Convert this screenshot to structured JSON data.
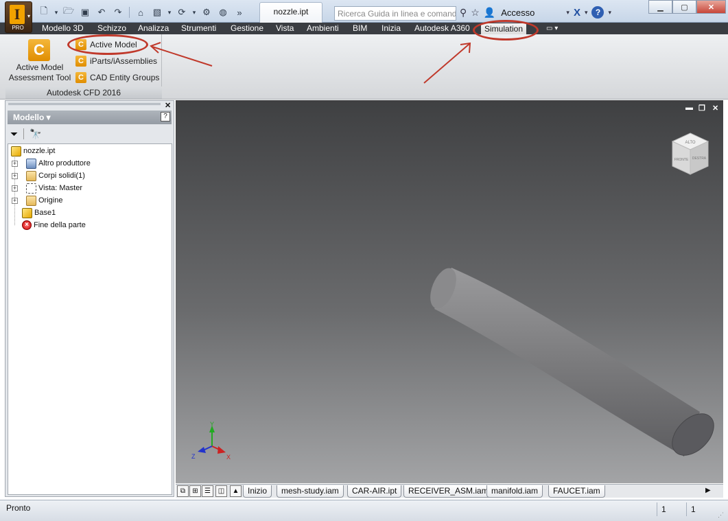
{
  "titlebar": {
    "app_badge": "I",
    "app_edition": "PRO",
    "document_title": "nozzle.ipt",
    "search_placeholder": "Ricerca Guida in linea e comand",
    "signin_label": "Accesso",
    "quick_access_icons": [
      "new-icon",
      "open-icon",
      "save-icon",
      "undo-icon",
      "redo-icon",
      "home-icon",
      "appearance-icon",
      "update-icon",
      "material-icon",
      "more-icon"
    ]
  },
  "ribbon_tabs": [
    "Modello 3D",
    "Schizzo",
    "Analizza",
    "Strumenti",
    "Gestione",
    "Vista",
    "Ambienti",
    "BIM",
    "Inizia",
    "Autodesk A360",
    "Simulation"
  ],
  "active_ribbon_tab": "Simulation",
  "ribbon_panel": {
    "large_button": {
      "line1": "Active Model",
      "line2": "Assessment Tool"
    },
    "small_buttons": [
      "Active Model",
      "iParts/iAssemblies",
      "CAD Entity Groups"
    ],
    "title": "Autodesk CFD 2016"
  },
  "browser": {
    "header": "Modello",
    "tree": [
      {
        "label": "nozzle.ipt",
        "icon": "part-icon",
        "expandable": false,
        "level": 0
      },
      {
        "label": "Altro produttore",
        "icon": "third-party-icon",
        "expandable": true,
        "level": 1
      },
      {
        "label": "Corpi solidi(1)",
        "icon": "solid-bodies-icon",
        "expandable": true,
        "level": 1
      },
      {
        "label": "Vista: Master",
        "icon": "view-rep-icon",
        "expandable": true,
        "level": 1
      },
      {
        "label": "Origine",
        "icon": "origin-folder-icon",
        "expandable": true,
        "level": 1
      },
      {
        "label": "Base1",
        "icon": "base-feature-icon",
        "expandable": false,
        "level": 1
      },
      {
        "label": "Fine della parte",
        "icon": "end-of-part-icon",
        "expandable": false,
        "level": 1
      }
    ]
  },
  "viewcube": {
    "top": "ALTO",
    "front": "FRONTE",
    "right": "DESTRA"
  },
  "axes": {
    "x": "X",
    "y": "Y",
    "z": "Z",
    "x_color": "#cc2222",
    "y_color": "#22aa22",
    "z_color": "#2233cc"
  },
  "document_tabs": [
    "Inizio",
    "mesh-study.iam",
    "CAR-AIR.ipt",
    "RECEIVER_ASM.iam",
    "manifold.iam",
    "FAUCET.iam"
  ],
  "status": {
    "text": "Pronto",
    "count_a": "1",
    "count_b": "1"
  },
  "colors": {
    "highlight": "#c0392b",
    "ribbon_dark": "#3a3d42",
    "icon_orange": "#e08d00"
  }
}
